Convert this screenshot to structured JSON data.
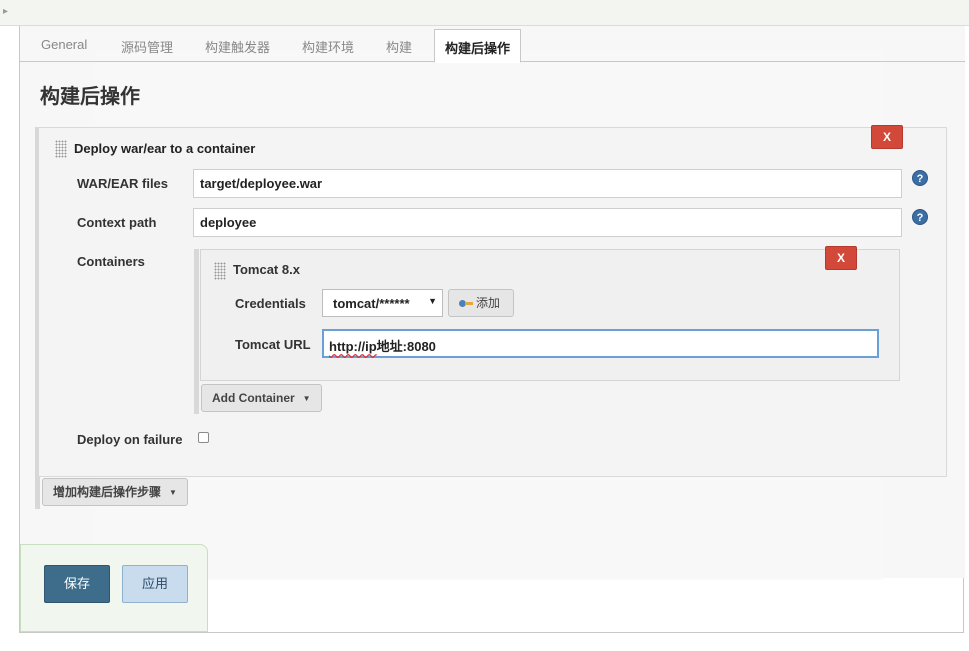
{
  "tabs": [
    {
      "label": "General"
    },
    {
      "label": "源码管理"
    },
    {
      "label": "构建触发器"
    },
    {
      "label": "构建环境"
    },
    {
      "label": "构建"
    },
    {
      "label": "构建后操作",
      "active": true
    }
  ],
  "section_title": "构建后操作",
  "deploy_step": {
    "title": "Deploy war/ear to a container",
    "delete_label": "X",
    "war_files": {
      "label": "WAR/EAR files",
      "value": "target/deployee.war"
    },
    "context_path": {
      "label": "Context path",
      "value": "deployee"
    },
    "containers_label": "Containers",
    "container": {
      "title": "Tomcat 8.x",
      "delete_label": "X",
      "credentials_label": "Credentials",
      "credentials_value": "tomcat/******",
      "add_label": "添加",
      "url_label": "Tomcat URL",
      "url_value_prefix": "http://ip",
      "url_value_rest": "地址:8080"
    },
    "add_container_label": "Add Container",
    "deploy_on_failure_label": "Deploy on failure",
    "deploy_on_failure_checked": false
  },
  "add_post_build_label": "增加构建后操作步骤",
  "help_glyph": "?",
  "footer": {
    "save_label": "保存",
    "apply_label": "应用"
  },
  "colors": {
    "delete_button": "#d24939",
    "save_button": "#3d6d8b",
    "apply_button": "#c9dced",
    "help_icon": "#3b6ea5"
  }
}
